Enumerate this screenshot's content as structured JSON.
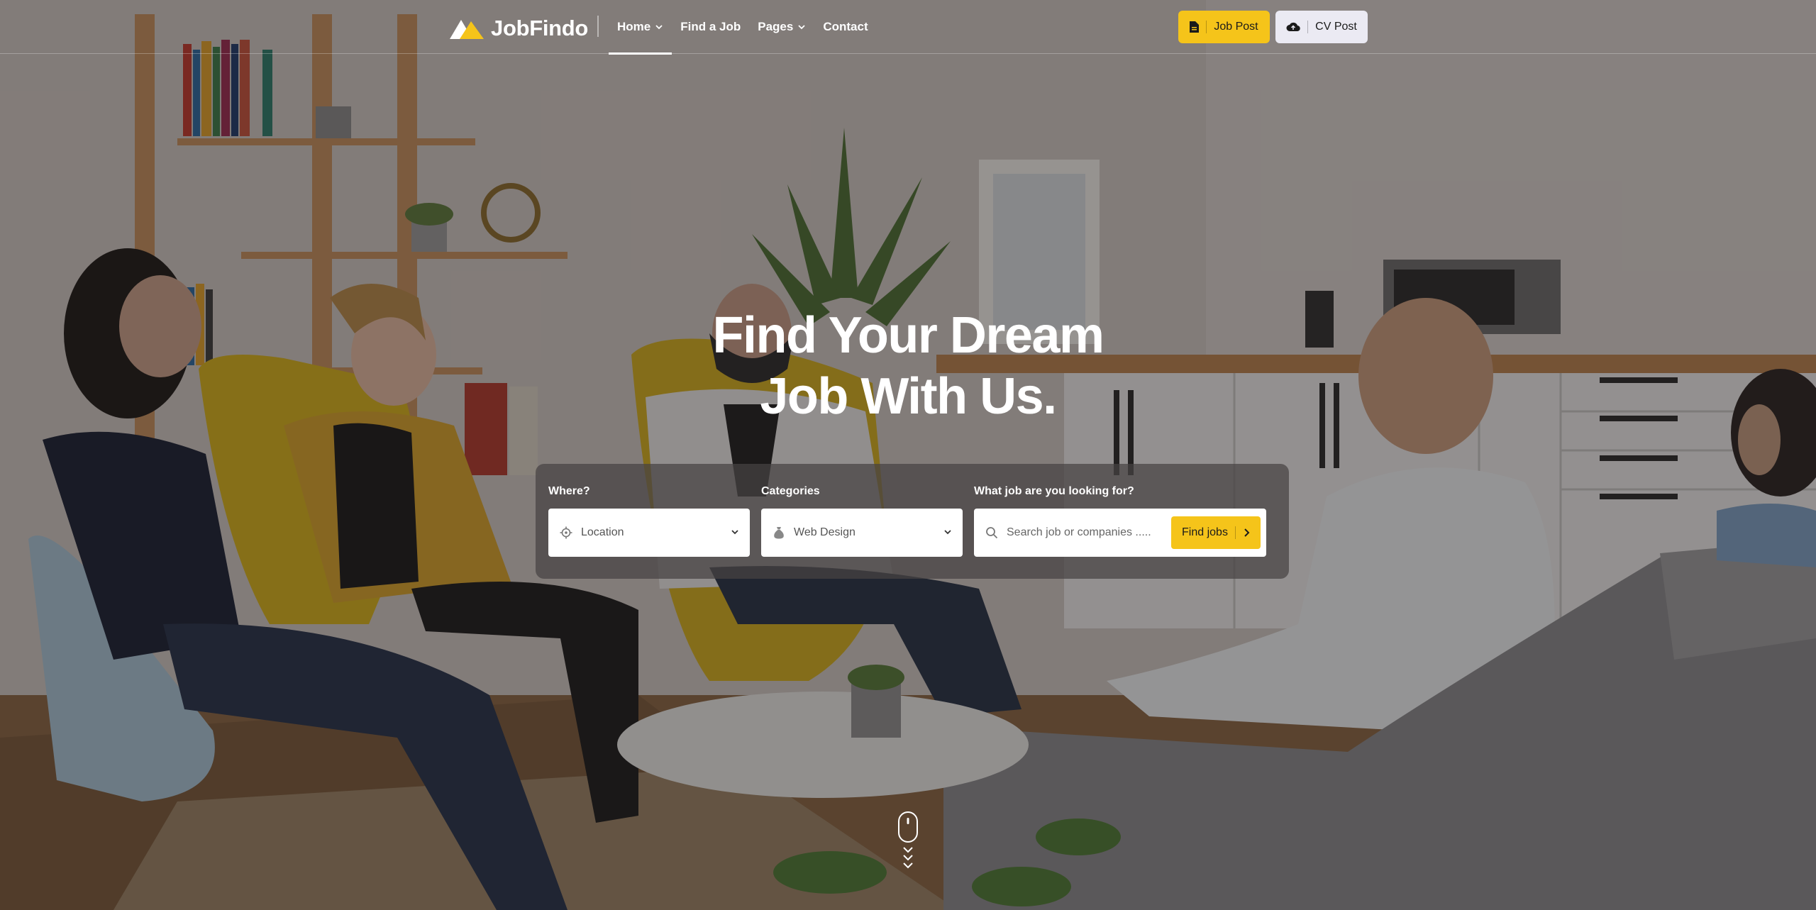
{
  "brand": {
    "name": "JobFindo",
    "accent": "#f5c41a"
  },
  "nav": {
    "items": [
      {
        "label": "Home",
        "has_dropdown": true,
        "active": true
      },
      {
        "label": "Find a Job",
        "has_dropdown": false,
        "active": false
      },
      {
        "label": "Pages",
        "has_dropdown": true,
        "active": false
      },
      {
        "label": "Contact",
        "has_dropdown": false,
        "active": false
      }
    ]
  },
  "header_actions": {
    "job_post": {
      "label": "Job Post",
      "icon": "document-icon"
    },
    "cv_post": {
      "label": "CV Post",
      "icon": "cloud-upload-icon"
    }
  },
  "hero": {
    "title_line1": "Find Your Dream",
    "title_line2": "Job With Us."
  },
  "search": {
    "where": {
      "label": "Where?",
      "value": "Location",
      "icon": "location-target-icon"
    },
    "categories": {
      "label": "Categories",
      "value": "Web Design",
      "icon": "money-bag-icon"
    },
    "query": {
      "label": "What job are you looking for?",
      "placeholder": "Search job or companies .....",
      "icon": "search-icon"
    },
    "submit_label": "Find jobs"
  },
  "scroll_indicator": {
    "icon": "mouse-scroll-icon"
  }
}
